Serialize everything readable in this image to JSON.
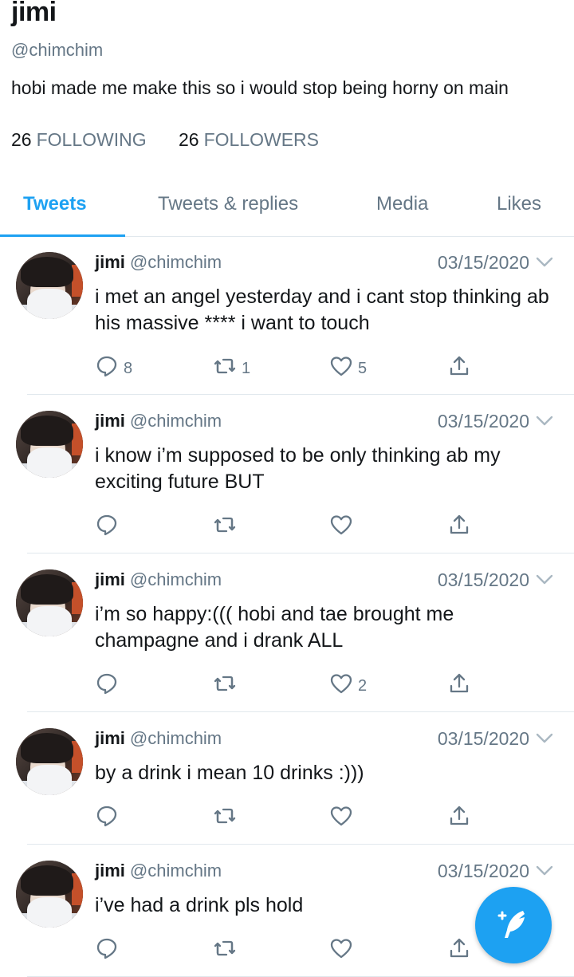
{
  "profile": {
    "display_name": "jimi",
    "handle": "@chimchim",
    "bio": "hobi made me make this so i would stop being horny on main",
    "following_count": "26",
    "following_label": "FOLLOWING",
    "followers_count": "26",
    "followers_label": "FOLLOWERS"
  },
  "tabs": [
    {
      "label": "Tweets",
      "active": true
    },
    {
      "label": "Tweets & replies",
      "active": false
    },
    {
      "label": "Media",
      "active": false
    },
    {
      "label": "Likes",
      "active": false
    }
  ],
  "tweets": [
    {
      "name": "jimi",
      "handle": "@chimchim",
      "date": "03/15/2020",
      "text": "i met an angel yesterday and i cant stop thinking ab his massive **** i want to touch",
      "replies": "8",
      "retweets": "1",
      "likes": "5"
    },
    {
      "name": "jimi",
      "handle": "@chimchim",
      "date": "03/15/2020",
      "text": "i know i’m supposed to be only thinking ab my exciting future BUT",
      "replies": "",
      "retweets": "",
      "likes": ""
    },
    {
      "name": "jimi",
      "handle": "@chimchim",
      "date": "03/15/2020",
      "text": "i’m so happy:((( hobi and tae brought me champagne and i drank ALL",
      "replies": "",
      "retweets": "",
      "likes": "2"
    },
    {
      "name": "jimi",
      "handle": "@chimchim",
      "date": "03/15/2020",
      "text": "by a drink i mean 10 drinks :)))",
      "replies": "",
      "retweets": "",
      "likes": ""
    },
    {
      "name": "jimi",
      "handle": "@chimchim",
      "date": "03/15/2020",
      "text": "i’ve had a drink pls hold",
      "replies": "",
      "retweets": "",
      "likes": ""
    }
  ],
  "icons": {
    "reply": "reply-icon",
    "retweet": "retweet-icon",
    "like": "heart-icon",
    "share": "share-icon",
    "caret": "chevron-down-icon",
    "compose": "compose-feather-icon"
  },
  "colors": {
    "accent": "#1da1f2",
    "text": "#14171a",
    "muted": "#657786",
    "divider": "#e1e8ed"
  }
}
